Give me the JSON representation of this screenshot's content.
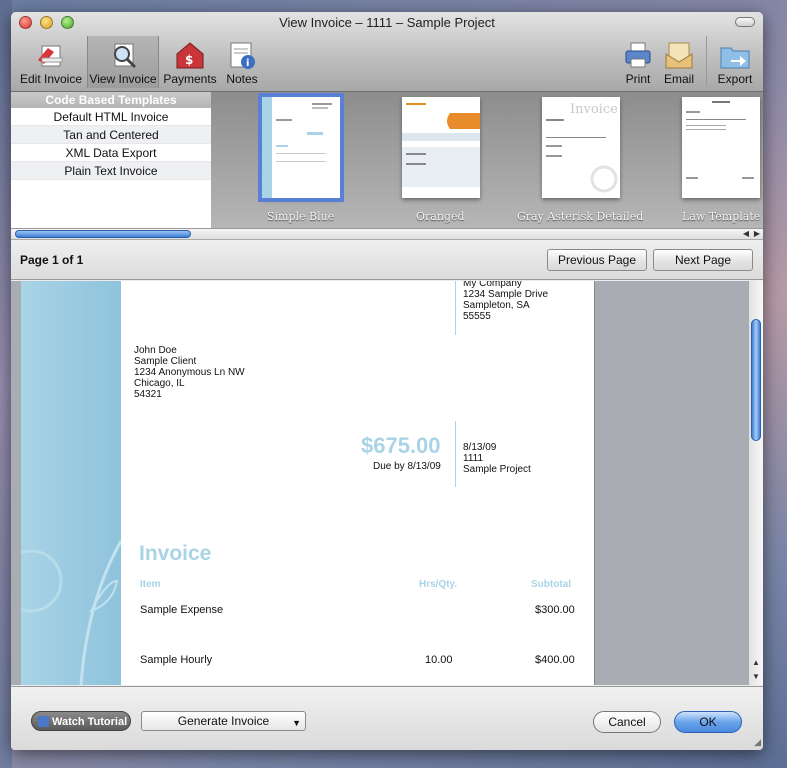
{
  "window": {
    "title": "View Invoice – 1111 – Sample Project"
  },
  "toolbar": {
    "edit_invoice": "Edit Invoice",
    "view_invoice": "View Invoice",
    "payments": "Payments",
    "notes": "Notes",
    "print": "Print",
    "email": "Email",
    "export": "Export"
  },
  "templates": {
    "header": "Code Based Templates",
    "list": [
      "Default HTML Invoice",
      "Tan and Centered",
      "XML Data Export",
      "Plain Text Invoice"
    ],
    "thumbnails": [
      "Simple Blue",
      "Oranged",
      "Gray Asterisk Detailed",
      "Law Template"
    ],
    "selected": "Simple Blue"
  },
  "pager": {
    "label": "Page 1 of 1",
    "prev": "Previous Page",
    "next": "Next Page"
  },
  "invoice": {
    "company": [
      "My Company",
      "1234 Sample Drive",
      "Sampleton, SA",
      "55555"
    ],
    "client": [
      "John Doe",
      "Sample Client",
      "1234 Anonymous Ln NW",
      "Chicago, IL",
      "54321"
    ],
    "amount": "$675.00",
    "due": "Due by 8/13/09",
    "meta": [
      "8/13/09",
      "1111",
      "Sample Project"
    ],
    "heading": "Invoice",
    "columns": {
      "item": "Item",
      "qty": "Hrs/Qty.",
      "subtotal": "Subtotal"
    },
    "rows": [
      {
        "item": "Sample Expense",
        "qty": "",
        "subtotal": "$300.00"
      },
      {
        "item": "Sample Hourly",
        "qty": "10.00",
        "subtotal": "$400.00"
      }
    ]
  },
  "footer": {
    "watch": "Watch Tutorial",
    "generate": "Generate Invoice",
    "cancel": "Cancel",
    "ok": "OK"
  }
}
